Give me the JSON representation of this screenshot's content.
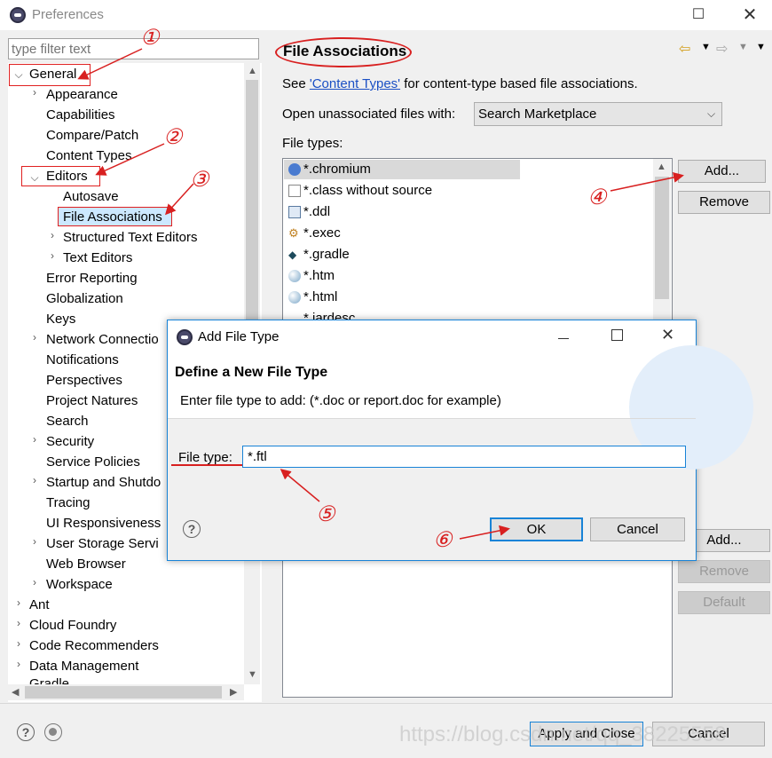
{
  "window": {
    "title": "Preferences"
  },
  "filter": {
    "placeholder": "type filter text"
  },
  "tree": {
    "general": "General",
    "items": [
      "Appearance",
      "Capabilities",
      "Compare/Patch",
      "Content Types"
    ],
    "editors": "Editors",
    "editor_children": [
      "Autosave",
      "File Associations",
      "Structured Text Editors",
      "Text Editors"
    ],
    "items2": [
      "Error Reporting",
      "Globalization",
      "Keys",
      "Network Connectio",
      "Notifications",
      "Perspectives",
      "Project Natures",
      "Search",
      "Security",
      "Service Policies",
      "Startup and Shutdo",
      "Tracing",
      "UI Responsiveness",
      "User Storage Servi",
      "Web Browser",
      "Workspace"
    ],
    "top_level": [
      "Ant",
      "Cloud Foundry",
      "Code Recommenders",
      "Data Management",
      "Gradle"
    ]
  },
  "page": {
    "title": "File Associations",
    "see_prefix": "See ",
    "see_link": "'Content Types'",
    "see_suffix": " for content-type based file associations.",
    "open_label": "Open unassociated files with:",
    "open_value": "Search Marketplace",
    "file_types_label": "File types:",
    "file_types": [
      "*.chromium",
      "*.class without source",
      "*.ddl",
      "*.exec",
      "*.gradle",
      "*.htm",
      "*.html",
      "*.jardesc"
    ],
    "add_label": "Add...",
    "remove_label": "Remove",
    "add2_label": "Add...",
    "remove2_label": "Remove",
    "default_label": "Default"
  },
  "footer": {
    "apply_close": "Apply and Close",
    "cancel": "Cancel",
    "watermark": "https://blog.csdn.net/qq_38225558"
  },
  "dialog": {
    "title": "Add File Type",
    "heading": "Define a New File Type",
    "description": "Enter file type to add: (*.doc or report.doc for example)",
    "field_label": "File type:",
    "field_value": "*.ftl",
    "ok": "OK",
    "cancel": "Cancel"
  },
  "annotations": [
    "①",
    "②",
    "③",
    "④",
    "⑤",
    "⑥"
  ],
  "colors": {
    "annotation": "#d82020",
    "link": "#1a4fc4",
    "focus": "#1883d7"
  }
}
